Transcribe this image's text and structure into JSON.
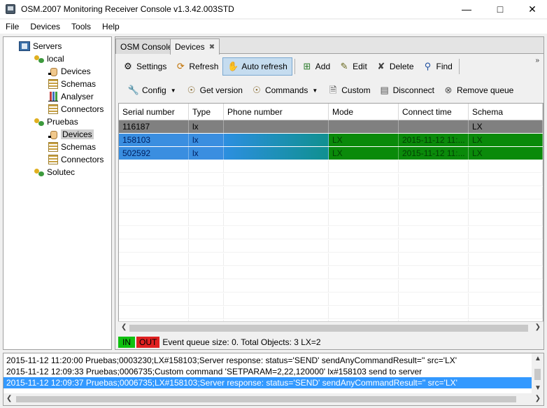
{
  "window": {
    "title": "OSM.2007 Monitoring Receiver Console v1.3.42.003STD"
  },
  "menu": {
    "items": [
      "File",
      "Devices",
      "Tools",
      "Help"
    ]
  },
  "tree": {
    "root": "Servers",
    "nodes": [
      {
        "label": "local",
        "children": [
          "Devices",
          "Schemas",
          "Analyser",
          "Connectors"
        ]
      },
      {
        "label": "Pruebas",
        "children": [
          "Devices",
          "Schemas",
          "Connectors"
        ],
        "selected_child": "Devices"
      },
      {
        "label": "Solutec",
        "children": []
      }
    ]
  },
  "tabs": [
    {
      "label": "OSM Console",
      "active": false
    },
    {
      "label": "Devices",
      "active": true,
      "closable": true
    }
  ],
  "toolbar1": {
    "settings": "Settings",
    "refresh": "Refresh",
    "auto_refresh": "Auto refresh",
    "add": "Add",
    "edit": "Edit",
    "delete": "Delete",
    "find": "Find"
  },
  "toolbar2": {
    "config": "Config",
    "get_version": "Get version",
    "commands": "Commands",
    "custom": "Custom",
    "disconnect": "Disconnect",
    "remove_queue": "Remove queue"
  },
  "grid": {
    "columns": [
      "Serial number",
      "Type",
      "Phone number",
      "Mode",
      "Connect time",
      "Schema"
    ],
    "rows": [
      {
        "serial": "116187",
        "type": "lx",
        "phone": "",
        "mode": "",
        "connect_time": "",
        "schema": "LX",
        "status": "gray"
      },
      {
        "serial": "158103",
        "type": "lx",
        "phone": "",
        "mode": "LX",
        "connect_time": "2015-11-12 11:...",
        "schema": "LX",
        "status": "green"
      },
      {
        "serial": "502592",
        "type": "lx",
        "phone": "",
        "mode": "LX",
        "connect_time": "2015-11-12 11:...",
        "schema": "LX",
        "status": "green"
      }
    ]
  },
  "status": {
    "in_label": "IN",
    "out_label": "OUT",
    "text": "Event queue size: 0.  Total Objects: 3   LX=2"
  },
  "log": [
    "2015-11-12 11:20:00  Pruebas;0003230;LX#158103;Server response: status='SEND' sendAnyCommandResult='' src='LX'",
    "2015-11-12 12:09:33  Pruebas;0006735;Custom command 'SETPARAM=2,22,120000' lx#158103 send to server",
    "2015-11-12 12:09:37  Pruebas;0006735;LX#158103;Server response: status='SEND' sendAnyCommandResult='' src='LX'"
  ],
  "colors": {
    "row_gray": "#808080",
    "row_green": "#0a8a0a",
    "selection": "#3399ff",
    "in": "#10c010",
    "out": "#e02020"
  }
}
